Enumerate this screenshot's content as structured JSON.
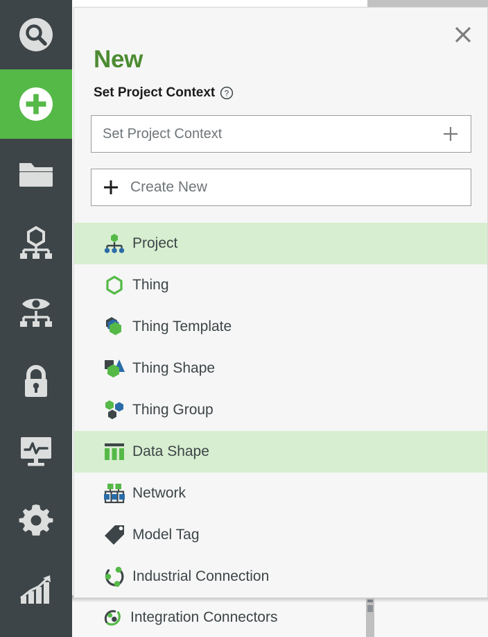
{
  "colors": {
    "brand_green": "#55b948",
    "title_green": "#4d8b32",
    "rail_dark": "#3d4548",
    "highlight_row": "#d8eed0",
    "icon_blue": "#2a6ca8",
    "icon_dark": "#3d4548",
    "icon_green": "#55b948",
    "modal_bg": "#f6f6f6"
  },
  "rail": {
    "items": [
      {
        "name": "search",
        "icon": "search-icon",
        "active": false
      },
      {
        "name": "new",
        "icon": "plus-circle-icon",
        "active": true
      },
      {
        "name": "browse",
        "icon": "folder-icon",
        "active": false
      },
      {
        "name": "modeling",
        "icon": "hierarchy-icon",
        "active": false
      },
      {
        "name": "visualization",
        "icon": "eye-hierarchy-icon",
        "active": false
      },
      {
        "name": "security",
        "icon": "lock-icon",
        "active": false
      },
      {
        "name": "monitoring",
        "icon": "monitor-pulse-icon",
        "active": false
      },
      {
        "name": "system",
        "icon": "gear-icon",
        "active": false
      },
      {
        "name": "analytics",
        "icon": "chart-growth-icon",
        "active": false
      }
    ]
  },
  "modal": {
    "title": "New",
    "close_label": "×",
    "field_label": "Set Project Context",
    "help_icon": "question-circle-icon",
    "context_input": {
      "value": "",
      "placeholder": "Set Project Context",
      "add_icon": "plus-icon"
    },
    "create_new": {
      "label": "Create New",
      "icon": "plus-icon"
    },
    "types": [
      {
        "label": "Project",
        "icon": "project-icon",
        "highlight": true
      },
      {
        "label": "Thing",
        "icon": "thing-icon",
        "highlight": false
      },
      {
        "label": "Thing Template",
        "icon": "thing-template-icon",
        "highlight": false
      },
      {
        "label": "Thing Shape",
        "icon": "thing-shape-icon",
        "highlight": false
      },
      {
        "label": "Thing Group",
        "icon": "thing-group-icon",
        "highlight": false
      },
      {
        "label": "Data Shape",
        "icon": "data-shape-icon",
        "highlight": true
      },
      {
        "label": "Network",
        "icon": "network-icon",
        "highlight": false
      },
      {
        "label": "Model Tag",
        "icon": "model-tag-icon",
        "highlight": false
      },
      {
        "label": "Industrial Connection",
        "icon": "industrial-connection-icon",
        "highlight": false
      }
    ]
  },
  "background": {
    "partial_item": {
      "label": "Integration Connectors",
      "icon": "integration-connectors-icon"
    }
  }
}
